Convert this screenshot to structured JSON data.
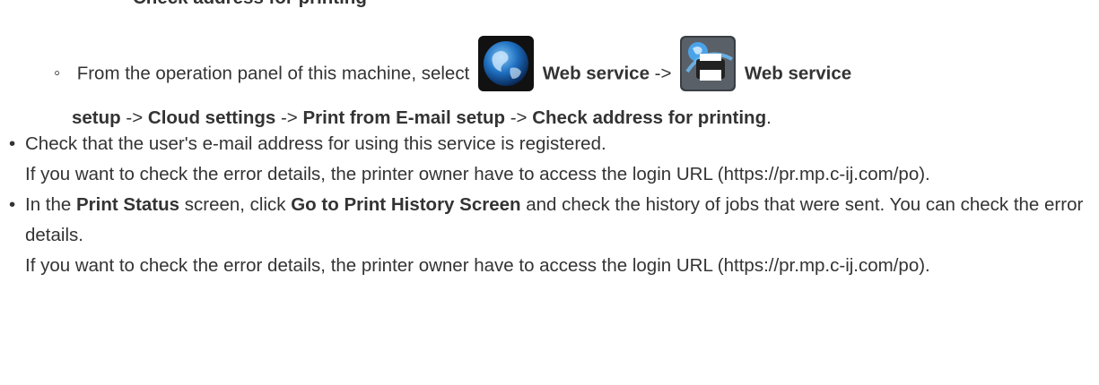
{
  "top_heading": "Check address for printing",
  "step": {
    "intro": "From the operation panel of this machine, select",
    "web_service": "Web service",
    "arrow": "->",
    "web_service_setup_part1": "Web service",
    "web_service_setup_part2": "setup",
    "cloud_settings": "Cloud settings",
    "print_from_email_setup": "Print from E-mail setup",
    "check_address": "Check address for printing",
    "end": "."
  },
  "bullets": [
    {
      "line1": "Check that the user's e-mail address for using this service is registered.",
      "line2": "If you want to check the error details, the printer owner have to access the login URL (https://pr.mp.c-ij.com/po)."
    },
    {
      "in_the": "In the",
      "print_status": "Print Status",
      "screen_click": "screen, click",
      "go_to_history": "Go to Print History Screen",
      "rest": "and check the history of jobs that were sent. You can check the error details.",
      "line2": "If you want to check the error details, the printer owner have to access the login URL (https://pr.mp.c-ij.com/po)."
    }
  ],
  "icons": {
    "globe": "globe-icon",
    "printer": "web-service-setup-icon"
  }
}
